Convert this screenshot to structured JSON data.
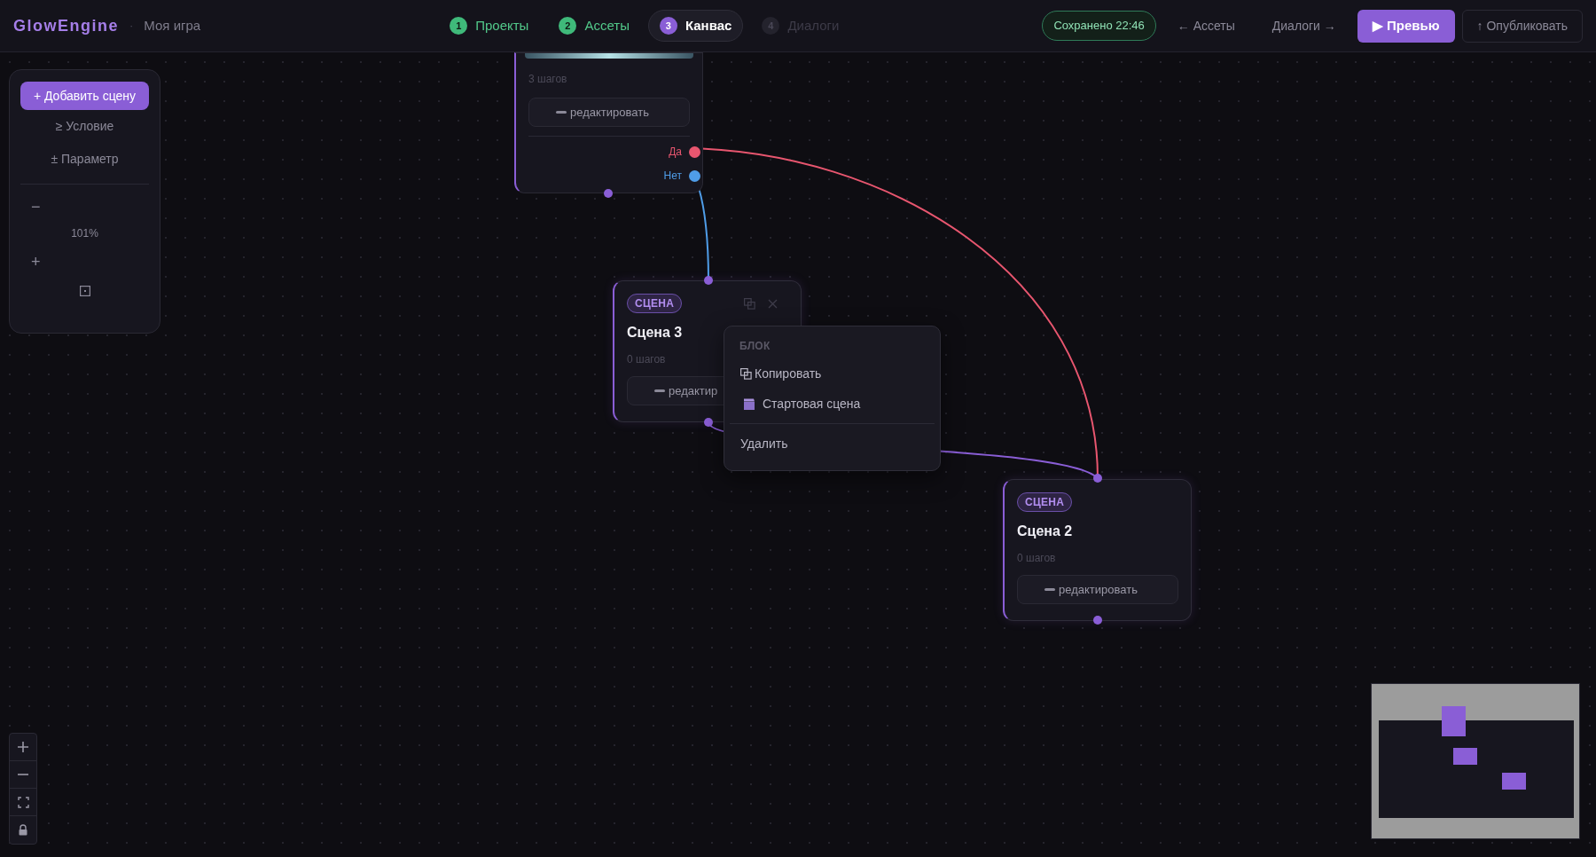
{
  "header": {
    "logo": "GlowEngine",
    "separator": "·",
    "project": "Моя игра",
    "steps": [
      {
        "number": "1",
        "label": "Проекты",
        "kind": "done"
      },
      {
        "number": "2",
        "label": "Ассеты",
        "kind": "done"
      },
      {
        "number": "3",
        "label": "Канвас",
        "kind": "current"
      },
      {
        "number": "4",
        "label": "Диалоги",
        "kind": "locked"
      }
    ],
    "save_status": "Сохранено 22:46",
    "back_link": "← Ассеты",
    "next_link": "Диалоги →",
    "preview_button": "▶ Превью",
    "publish_button": "↑ Опубликовать"
  },
  "toolbox": {
    "add_button": "+ Добавить сцену",
    "items": [
      "≥ Условие",
      "± Параметр"
    ],
    "zoom_out": "−",
    "zoom_value": "101%",
    "zoom_in": "+"
  },
  "nodes": [
    {
      "kind": "branch",
      "steps": "3 шагов",
      "edit_label": "редактировать",
      "outputs": [
        {
          "label": "Да",
          "color": "#e8566f"
        },
        {
          "label": "Нет",
          "color": "#4f9de8"
        }
      ]
    },
    {
      "kind": "scene",
      "badge": "СЦЕНА",
      "title": "Сцена 3",
      "steps": "0 шагов",
      "edit_label": "редактир",
      "actions_visible": true
    },
    {
      "kind": "scene",
      "badge": "СЦЕНА",
      "title": "Сцена 2",
      "steps": "0 шагов",
      "edit_label": "редактировать",
      "actions_visible": false
    }
  ],
  "context_menu": {
    "section": "БЛОК",
    "items": [
      {
        "kind": "copy",
        "label": "Копировать"
      },
      {
        "kind": "start",
        "label": "Стартовая сцена"
      },
      {
        "kind": "delete",
        "label": "Удалить"
      }
    ]
  }
}
